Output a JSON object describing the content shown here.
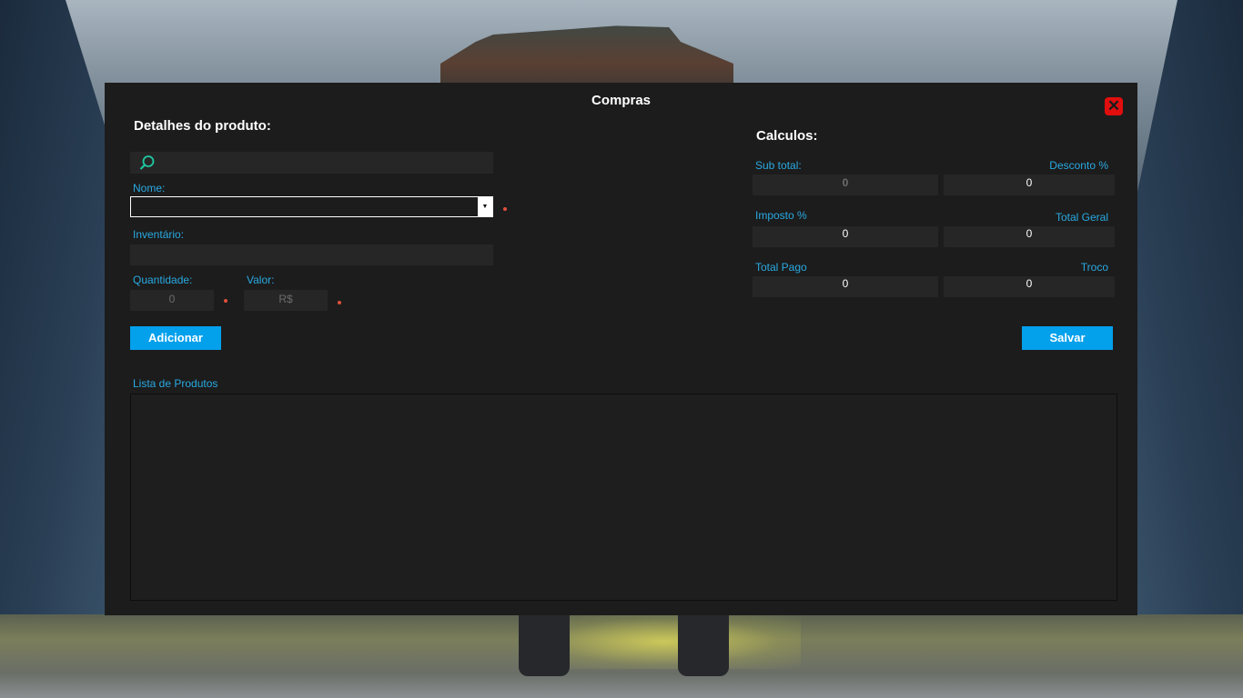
{
  "window": {
    "title": "Compras",
    "close_icon": "close-icon",
    "close_color": "#e10e0e"
  },
  "product_details": {
    "heading": "Detalhes do produto:",
    "search": {
      "icon": "search-icon",
      "value": ""
    },
    "nome": {
      "label": "Nome:",
      "value": ""
    },
    "inventario": {
      "label": "Inventário:",
      "value": ""
    },
    "quantidade": {
      "label": "Quantidade:",
      "value": "0"
    },
    "valor": {
      "label": "Valor:",
      "value": "R$"
    },
    "add_button": "Adicionar"
  },
  "calculations": {
    "heading": "Calculos:",
    "sub_total": {
      "label": "Sub total:",
      "value": "0"
    },
    "desconto": {
      "label": "Desconto %",
      "value": "0"
    },
    "imposto": {
      "label": "Imposto %",
      "value": "0"
    },
    "total_geral": {
      "label": "Total Geral",
      "value": "0"
    },
    "total_pago": {
      "label": "Total Pago",
      "value": "0"
    },
    "troco": {
      "label": "Troco",
      "value": "0"
    },
    "save_button": "Salvar"
  },
  "product_list": {
    "label": "Lista de Produtos",
    "rows": []
  },
  "colors": {
    "accent": "#03a0ec",
    "label": "#29a9e1",
    "required": "#e0503a",
    "panel": "#1c1c1c"
  }
}
